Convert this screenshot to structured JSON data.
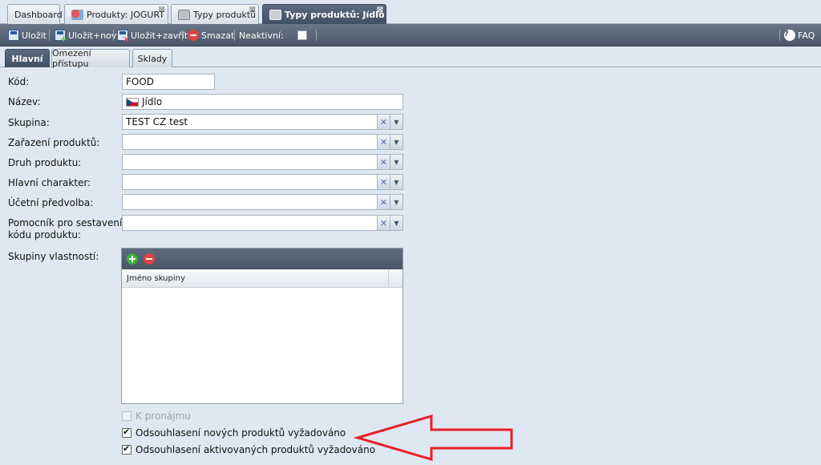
{
  "tabs": [
    {
      "label": "Dashboard",
      "active": false,
      "closable": false
    },
    {
      "label": "Produkty: JOGURT",
      "active": false,
      "closable": true,
      "icon": "product-icon"
    },
    {
      "label": "Typy produktů",
      "active": false,
      "closable": true,
      "icon": "product-type-icon"
    },
    {
      "label": "Typy produktů: Jídlo",
      "active": true,
      "closable": true,
      "icon": "product-type-icon"
    }
  ],
  "toolbar": {
    "save_label": "Uložit",
    "save_new_label": "Uložit+nový",
    "save_close_label": "Uložit+zavřít",
    "delete_label": "Smazat",
    "inactive_label": "Neaktivní:",
    "inactive_checked": false,
    "faq_label": "FAQ"
  },
  "subtabs": [
    {
      "label": "Hlavní",
      "active": true
    },
    {
      "label": "Omezení přístupu",
      "active": false
    },
    {
      "label": "Sklady",
      "active": false
    }
  ],
  "form": {
    "code": {
      "label": "Kód:",
      "value": "FOOD"
    },
    "name": {
      "label": "Název:",
      "value": "Jídlo",
      "flag": "cz-flag-icon"
    },
    "group": {
      "label": "Skupina:",
      "value": "TEST CZ test"
    },
    "classification": {
      "label": "Zařazení produktů:",
      "value": ""
    },
    "kind": {
      "label": "Druh produktu:",
      "value": ""
    },
    "main_character": {
      "label": "Hlavní charakter:",
      "value": ""
    },
    "accounting_preset": {
      "label": "Účetní předvolba:",
      "value": ""
    },
    "code_helper": {
      "label_line1": "Pomocník pro sestavení",
      "label_line2": "kódu produktu:",
      "value": ""
    },
    "property_groups": {
      "label": "Skupiny vlastností:",
      "column_header": "Jméno skupiny",
      "rows": []
    },
    "rentable": {
      "label": "K pronájmu",
      "checked": false,
      "disabled": true
    },
    "approval_new": {
      "label": "Odsouhlasení nových produktů vyžadováno",
      "checked": true
    },
    "approval_activated": {
      "label": "Odsouhlasení aktivovaných produktů vyžadováno",
      "checked": true
    }
  },
  "colors": {
    "background": "#dfe8f2",
    "toolbar": "#5b6879",
    "active_tab": "#4a5a6e",
    "annotation_arrow": "#e8202a"
  }
}
